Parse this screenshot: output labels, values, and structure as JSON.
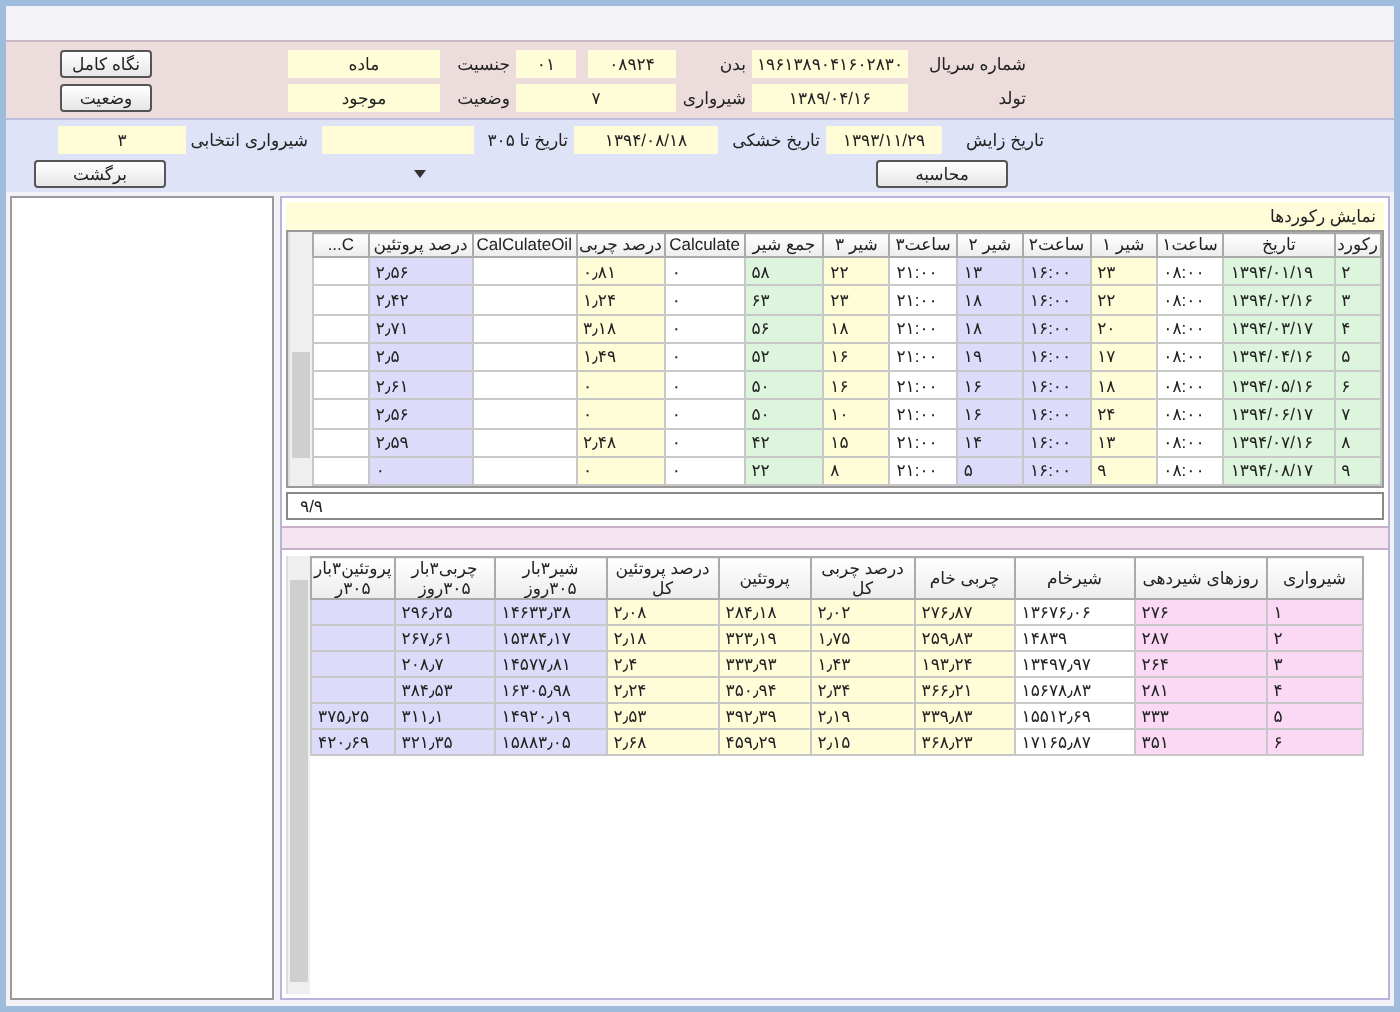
{
  "animal": {
    "serial": {
      "label": "شماره سریال",
      "value": "۱۹۶۱۳۸۹۰۴۱۶۰۲۸۳۰"
    },
    "body": {
      "label": "بدن",
      "value": "۰۸۹۲۴",
      "code": "۰۱"
    },
    "sex": {
      "label": "جنسیت",
      "value": "ماده"
    },
    "birth": {
      "label": "تولد",
      "value": "۱۳۸۹/۰۴/۱۶"
    },
    "lactation": {
      "label": "شیرواری",
      "value": "۷"
    },
    "status": {
      "label": "وضعیت",
      "value": "موجود"
    },
    "buttons": [
      "نگاه کامل",
      "وضعیت"
    ]
  },
  "calc": {
    "calving": {
      "label": "تاریخ زایش",
      "value": "۱۳۹۳/۱۱/۲۹"
    },
    "dry": {
      "label": "تاریخ خشکی",
      "value": "۱۳۹۴/۰۸/۱۸"
    },
    "to305": {
      "label": "تاریخ تا ۳۰۵"
    },
    "selected_lactation": {
      "label": "شیرواری انتخابی",
      "value": "۳"
    },
    "calculate_button": "محاسبه",
    "back_button": "برگشت"
  },
  "top_grid": {
    "title": "نمایش رکوردها",
    "navigator": "۹/۹",
    "columns": [
      {
        "label": "رکورد",
        "color": "#dcf5dc"
      },
      {
        "label": "تاریخ",
        "color": "#dcf5dc"
      },
      {
        "label": "ساعت۱",
        "color": "#ffffff"
      },
      {
        "label": "شیر ۱",
        "color": "#fffcd8"
      },
      {
        "label": "ساعت۲",
        "color": "#dcdcfa"
      },
      {
        "label": "شیر ۲",
        "color": "#dcdcfa"
      },
      {
        "label": "ساعت۳",
        "color": "#ffffff"
      },
      {
        "label": "شیر ۳",
        "color": "#fffcd8"
      },
      {
        "label": "جمع شیر",
        "color": "#dcf5dc"
      },
      {
        "label": "Calculate",
        "color": "#ffffff"
      },
      {
        "label": "درصد چربی",
        "color": "#fffcd8"
      },
      {
        "label": "CalCulateOil",
        "color": "#ffffff"
      },
      {
        "label": "درصد پروتئین",
        "color": "#dcdcfa"
      },
      {
        "label": "C...",
        "color": "#ffffff"
      }
    ],
    "rows": [
      [
        "۲",
        "۱۳۹۴/۰۱/۱۹",
        "۰۸:۰۰",
        "۲۳",
        "۱۶:۰۰",
        "۱۳",
        "۲۱:۰۰",
        "۲۲",
        "۵۸",
        "۰",
        "۰٫۸۱",
        null,
        "۲٫۵۶",
        null
      ],
      [
        "۳",
        "۱۳۹۴/۰۲/۱۶",
        "۰۸:۰۰",
        "۲۲",
        "۱۶:۰۰",
        "۱۸",
        "۲۱:۰۰",
        "۲۳",
        "۶۳",
        "۰",
        "۱٫۲۴",
        null,
        "۲٫۴۲",
        null
      ],
      [
        "۴",
        "۱۳۹۴/۰۳/۱۷",
        "۰۸:۰۰",
        "۲۰",
        "۱۶:۰۰",
        "۱۸",
        "۲۱:۰۰",
        "۱۸",
        "۵۶",
        "۰",
        "۳٫۱۸",
        null,
        "۲٫۷۱",
        null
      ],
      [
        "۵",
        "۱۳۹۴/۰۴/۱۶",
        "۰۸:۰۰",
        "۱۷",
        "۱۶:۰۰",
        "۱۹",
        "۲۱:۰۰",
        "۱۶",
        "۵۲",
        "۰",
        "۱٫۴۹",
        null,
        "۲٫۵",
        null
      ],
      [
        "۶",
        "۱۳۹۴/۰۵/۱۶",
        "۰۸:۰۰",
        "۱۸",
        "۱۶:۰۰",
        "۱۶",
        "۲۱:۰۰",
        "۱۶",
        "۵۰",
        "۰",
        "۰",
        null,
        "۲٫۶۱",
        null
      ],
      [
        "۷",
        "۱۳۹۴/۰۶/۱۷",
        "۰۸:۰۰",
        "۲۴",
        "۱۶:۰۰",
        "۱۶",
        "۲۱:۰۰",
        "۱۰",
        "۵۰",
        "۰",
        "۰",
        null,
        "۲٫۵۶",
        null
      ],
      [
        "۸",
        "۱۳۹۴/۰۷/۱۶",
        "۰۸:۰۰",
        "۱۳",
        "۱۶:۰۰",
        "۱۴",
        "۲۱:۰۰",
        "۱۵",
        "۴۲",
        "۰",
        "۲٫۴۸",
        null,
        "۲٫۵۹",
        null
      ],
      [
        "۹",
        "۱۳۹۴/۰۸/۱۷",
        "۰۸:۰۰",
        "۹",
        "۱۶:۰۰",
        "۵",
        "۲۱:۰۰",
        "۸",
        "۲۲",
        "۰",
        "۰",
        null,
        "۰",
        null
      ]
    ]
  },
  "bottom_grid": {
    "columns": [
      {
        "label": "شیرواری",
        "color": "#fbd8f4"
      },
      {
        "label": "روزهای شیردهی",
        "color": "#fbd8f4"
      },
      {
        "label": "شیرخام",
        "color": "#ffffff"
      },
      {
        "label": "چربی خام",
        "color": "#fffcd8"
      },
      {
        "label": "درصد چربی کل",
        "color": "#fffcd8"
      },
      {
        "label": "پروتئین",
        "color": "#fffcd8"
      },
      {
        "label": "درصد پروتئین کل",
        "color": "#fffcd8"
      },
      {
        "label": "شیر۳بار ۳۰۵روز",
        "color": "#dcdcfa"
      },
      {
        "label": "چربی۳بار ۳۰۵روز",
        "color": "#dcdcfa"
      },
      {
        "label": "پروتئین۳بار ۳۰۵ر",
        "color": "#dcdcfa"
      }
    ],
    "rows": [
      [
        "۱",
        "۲۷۶",
        "۱۳۶۷۶٫۰۶",
        "۲۷۶٫۸۷",
        "۲٫۰۲",
        "۲۸۴٫۱۸",
        "۲٫۰۸",
        "۱۴۶۳۳٫۳۸",
        "۲۹۶٫۲۵",
        null
      ],
      [
        "۲",
        "۲۸۷",
        "۱۴۸۳۹",
        "۲۵۹٫۸۳",
        "۱٫۷۵",
        "۳۲۳٫۱۹",
        "۲٫۱۸",
        "۱۵۳۸۴٫۱۷",
        "۲۶۷٫۶۱",
        null
      ],
      [
        "۳",
        "۲۶۴",
        "۱۳۴۹۷٫۹۷",
        "۱۹۳٫۲۴",
        "۱٫۴۳",
        "۳۳۳٫۹۳",
        "۲٫۴",
        "۱۴۵۷۷٫۸۱",
        "۲۰۸٫۷",
        null
      ],
      [
        "۴",
        "۲۸۱",
        "۱۵۶۷۸٫۸۳",
        "۳۶۶٫۲۱",
        "۲٫۳۴",
        "۳۵۰٫۹۴",
        "۲٫۲۴",
        "۱۶۳۰۵٫۹۸",
        "۳۸۴٫۵۳",
        null
      ],
      [
        "۵",
        "۳۳۳",
        "۱۵۵۱۲٫۶۹",
        "۳۳۹٫۸۳",
        "۲٫۱۹",
        "۳۹۲٫۳۹",
        "۲٫۵۳",
        "۱۴۹۲۰٫۱۹",
        "۳۱۱٫۱",
        "۳۷۵٫۲۵"
      ],
      [
        "۶",
        "۳۵۱",
        "۱۷۱۶۵٫۸۷",
        "۳۶۸٫۲۳",
        "۲٫۱۵",
        "۴۵۹٫۲۹",
        "۲٫۶۸",
        "۱۵۸۸۳٫۰۵",
        "۳۲۱٫۳۵",
        "۴۲۰٫۶۹"
      ]
    ]
  }
}
